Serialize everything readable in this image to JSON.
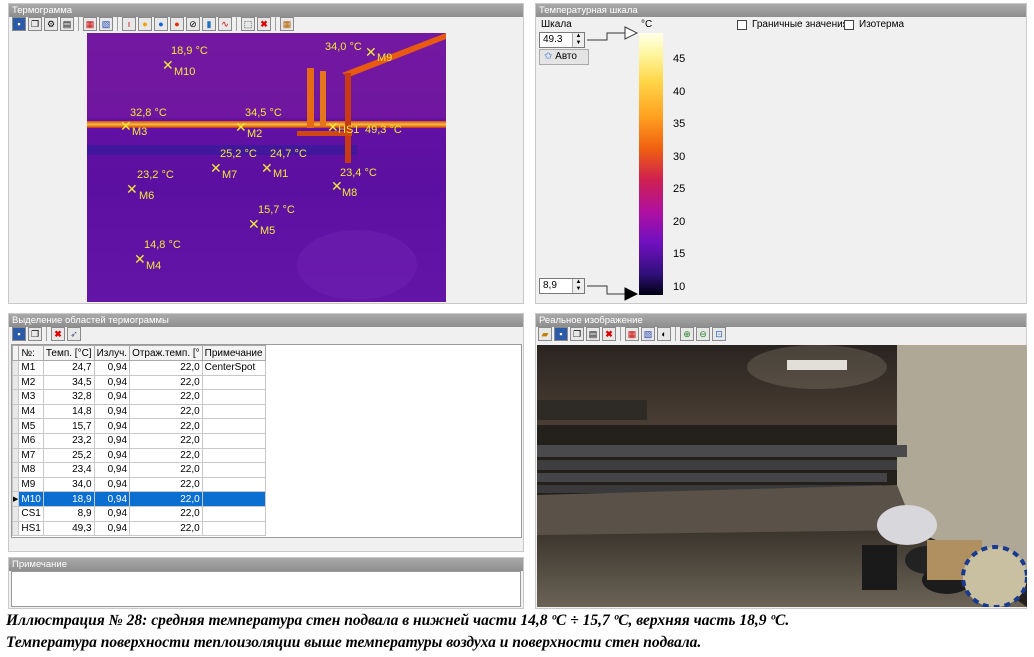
{
  "thermogram_panel": {
    "title": "Термограмма"
  },
  "scale_panel": {
    "title": "Температурная шкала",
    "scale_label": "Шкала",
    "unit": "°C",
    "max_value": "49.3",
    "min_value": "8,9",
    "auto_button": "Авто",
    "boundary_label": "Граничные значения",
    "isotherm_label": "Изотерма",
    "ticks": [
      "45",
      "40",
      "35",
      "30",
      "25",
      "20",
      "15",
      "10"
    ]
  },
  "markers": [
    {
      "id": "M10",
      "temp": "18,9 °C"
    },
    {
      "id": "M9",
      "temp": "34,0 °C"
    },
    {
      "id": "M3",
      "temp": "32,8 °C"
    },
    {
      "id": "M2",
      "temp": "34,5 °C"
    },
    {
      "id": "HS1",
      "temp": "49,3 °C"
    },
    {
      "id": "M7",
      "temp": "25,2 °C"
    },
    {
      "id": "M1",
      "temp": "24,7 °C"
    },
    {
      "id": "M6",
      "temp": "23,2 °C"
    },
    {
      "id": "M8",
      "temp": "23,4 °C"
    },
    {
      "id": "M5",
      "temp": "15,7 °C"
    },
    {
      "id": "M4",
      "temp": "14,8 °C"
    }
  ],
  "regions_panel": {
    "title": "Выделение областей термограммы",
    "columns": [
      "№:",
      "Темп. [°C]",
      "Излуч.",
      "Отраж.темп. [°",
      "Примечание"
    ],
    "rows": [
      [
        "M1",
        "24,7",
        "0,94",
        "22,0",
        "CenterSpot"
      ],
      [
        "M2",
        "34,5",
        "0,94",
        "22,0",
        ""
      ],
      [
        "M3",
        "32,8",
        "0,94",
        "22,0",
        ""
      ],
      [
        "M4",
        "14,8",
        "0,94",
        "22,0",
        ""
      ],
      [
        "M5",
        "15,7",
        "0,94",
        "22,0",
        ""
      ],
      [
        "M6",
        "23,2",
        "0,94",
        "22,0",
        ""
      ],
      [
        "M7",
        "25,2",
        "0,94",
        "22,0",
        ""
      ],
      [
        "M8",
        "23,4",
        "0,94",
        "22,0",
        ""
      ],
      [
        "M9",
        "34,0",
        "0,94",
        "22,0",
        ""
      ],
      [
        "M10",
        "18,9",
        "0,94",
        "22,0",
        ""
      ],
      [
        "CS1",
        "8,9",
        "0,94",
        "22,0",
        ""
      ],
      [
        "HS1",
        "49,3",
        "0,94",
        "22,0",
        ""
      ]
    ],
    "selected_row": "M10"
  },
  "note_panel": {
    "title": "Примечание"
  },
  "photo_panel": {
    "title": "Реальное изображение"
  },
  "caption": {
    "line1": "Иллюстрация № 28: средняя температура стен подвала в нижней части 14,8 ºС ÷ 15,7 ºС, верхняя часть 18,9 ºС.",
    "line2": "Температура поверхности теплоизоляции выше температуры воздуха и поверхности стен подвала."
  },
  "colors": {
    "marker": "#f2e83a",
    "selection": "#0a6fd1",
    "thermo_bg": "#5a10a0"
  }
}
